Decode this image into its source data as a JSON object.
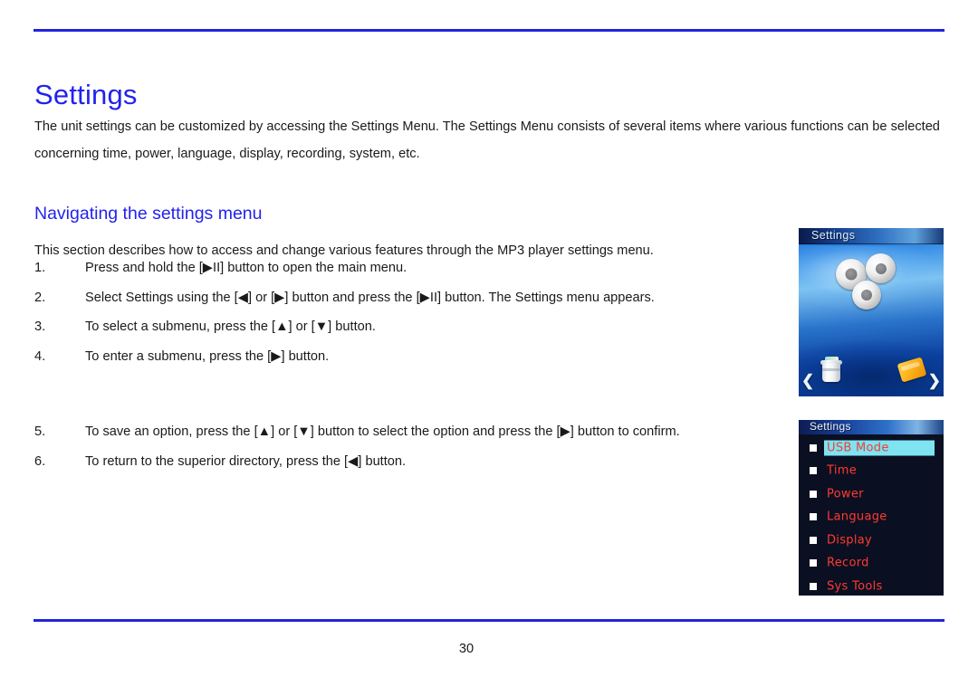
{
  "document": {
    "page_title": "Settings",
    "intro": "The unit settings can be customized by accessing the Settings Menu. The Settings Menu consists of several items where various functions can be selected concerning time, power, language, display, recording, system, etc.",
    "section_heading": "Navigating the settings menu",
    "lead": "This section describes how to access and change various features through the MP3 player settings menu.",
    "page_number": "30",
    "accent_color": "#2222ee",
    "text_color": "#1a1a1a"
  },
  "steps": [
    {
      "num": "1.",
      "text": "Press and hold the [▶II] button to open the main menu."
    },
    {
      "num": "2.",
      "text": "Select Settings using the [◀] or [▶] button and press the [▶II] button. The Settings menu appears."
    },
    {
      "num": "3.",
      "text": "To select a submenu, press the [▲] or [▼] button."
    },
    {
      "num": "4.",
      "text": "To enter a submenu, press the [▶] button."
    }
  ],
  "steps_late": [
    {
      "num": "5.",
      "text": "To save an option, press the [▲] or [▼] button to select the option and press the [▶] button to confirm."
    },
    {
      "num": "6.",
      "text": "To return to the superior directory, press the [◀] button."
    }
  ],
  "device_main": {
    "title": "Settings",
    "icons": {
      "gears": "gears-icon",
      "trash": "trash-bin-icon",
      "folder": "folder-card-icon",
      "prev": "❮",
      "next": "❯"
    }
  },
  "device_list": {
    "title": "Settings",
    "selected_color": "#7fe3f2",
    "item_color": "#ff3b2e",
    "background_color": "#0b0f22",
    "items": [
      {
        "label": "USB Mode",
        "selected": true
      },
      {
        "label": "Time",
        "selected": false
      },
      {
        "label": "Power",
        "selected": false
      },
      {
        "label": "Language",
        "selected": false
      },
      {
        "label": "Display",
        "selected": false
      },
      {
        "label": "Record",
        "selected": false
      },
      {
        "label": "Sys Tools",
        "selected": false
      }
    ]
  }
}
